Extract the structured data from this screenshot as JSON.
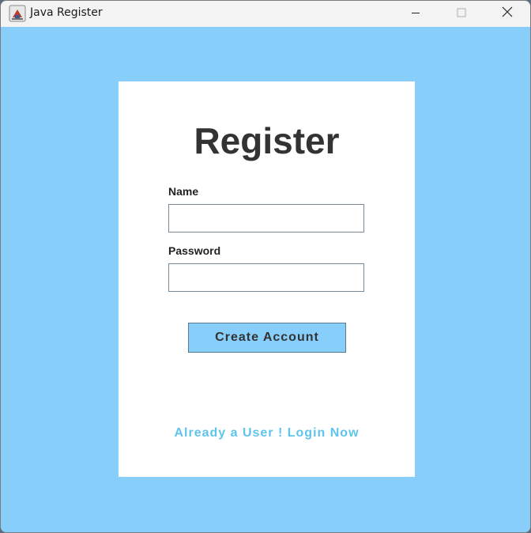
{
  "window": {
    "title": "Java Register",
    "controls": [
      "minimize",
      "maximize",
      "close"
    ]
  },
  "form": {
    "heading": "Register",
    "name_label": "Name",
    "name_value": "",
    "password_label": "Password",
    "password_value": "",
    "submit_label": "Create Account",
    "login_link": "Already a User ! Login Now"
  },
  "colors": {
    "background": "#87cefa",
    "card": "#ffffff",
    "button": "#87cefa",
    "link": "#5fc4ec",
    "heading": "#333333"
  },
  "icons": {
    "app": "java-coffee-icon",
    "minimize": "minimize-icon",
    "maximize": "maximize-icon",
    "close": "close-icon"
  }
}
